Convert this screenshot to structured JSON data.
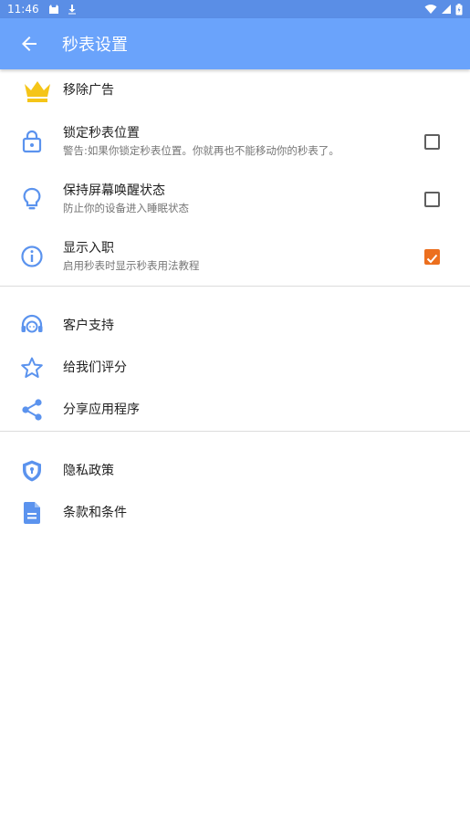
{
  "status": {
    "time": "11:46"
  },
  "toolbar": {
    "title": "秒表设置"
  },
  "settings": [
    {
      "label": "移除广告",
      "icon": "crown-icon"
    },
    {
      "label": "锁定秒表位置",
      "sub": "警告:如果你锁定秒表位置。你就再也不能移动你的秒表了。",
      "icon": "lock-icon",
      "checked": false
    },
    {
      "label": "保持屏幕唤醒状态",
      "sub": "防止你的设备进入睡眠状态",
      "icon": "lightbulb-icon",
      "checked": false
    },
    {
      "label": "显示入职",
      "sub": "启用秒表时显示秒表用法教程",
      "icon": "info-icon",
      "checked": true
    }
  ],
  "support": [
    {
      "label": "客户支持",
      "icon": "headset-icon"
    },
    {
      "label": "给我们评分",
      "icon": "star-icon"
    },
    {
      "label": "分享应用程序",
      "icon": "share-icon"
    }
  ],
  "legal": [
    {
      "label": "隐私政策",
      "icon": "shield-icon"
    },
    {
      "label": "条款和条件",
      "icon": "document-icon"
    }
  ],
  "colors": {
    "toolbar": "#6aa3fb",
    "status_bar": "#5a8ee6",
    "icon": "#5b93ee",
    "crown": "#f5c518",
    "checkbox_on": "#ec6f1e"
  }
}
